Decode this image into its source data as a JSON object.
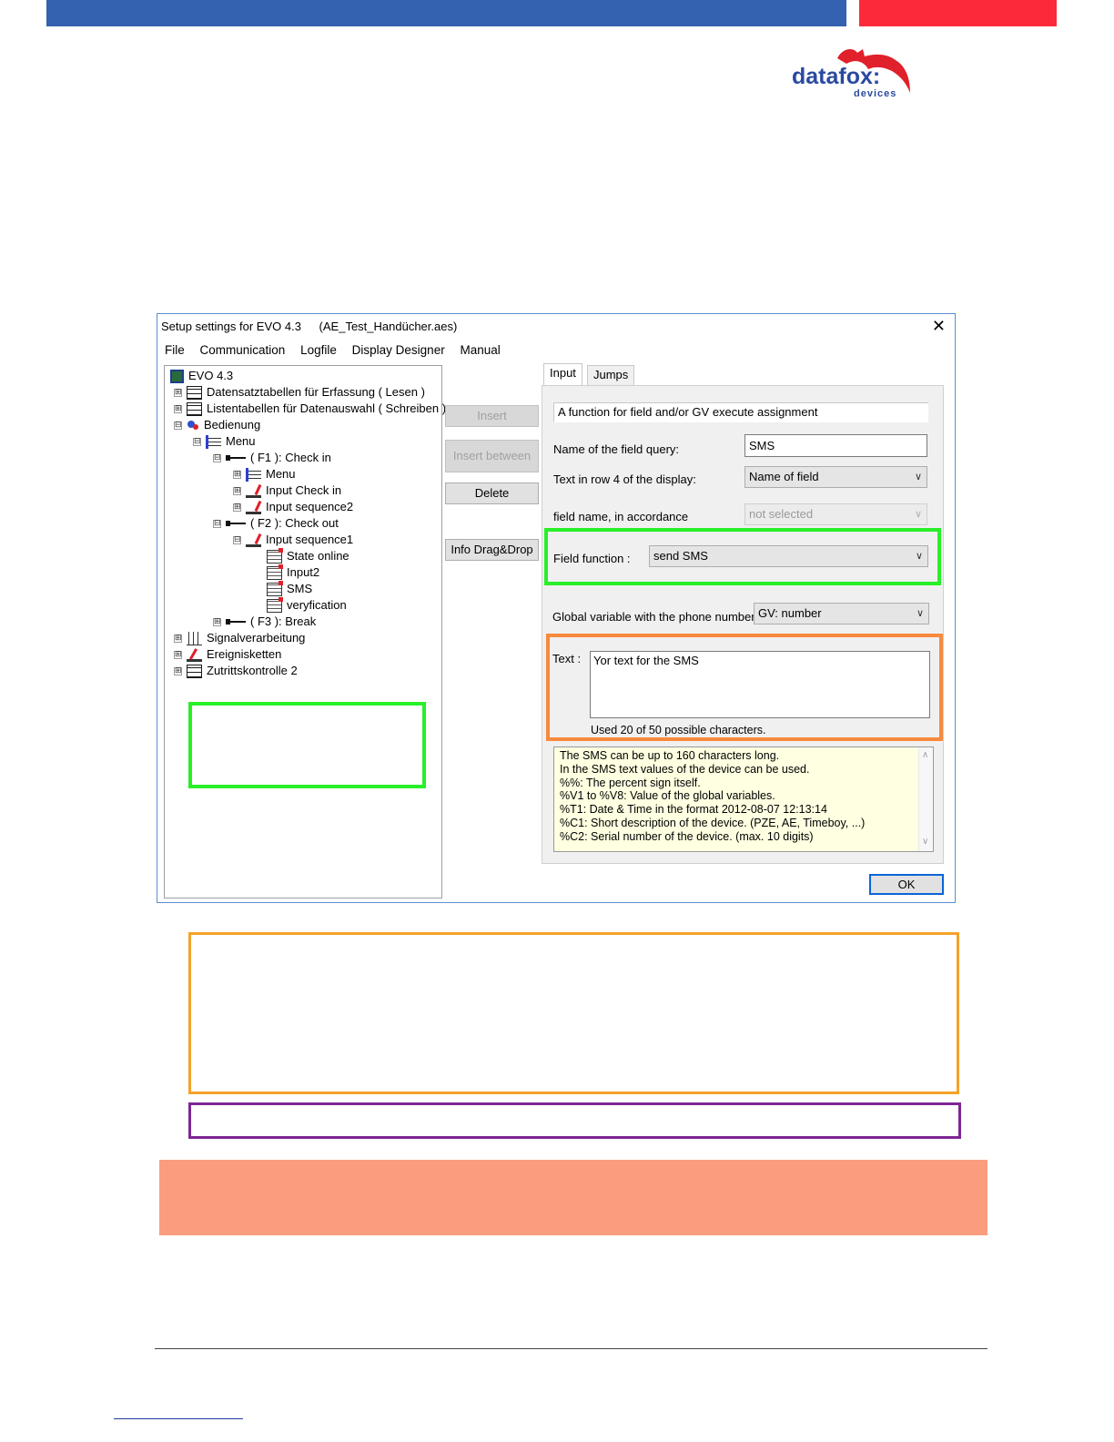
{
  "brand": {
    "logo_main": "datafox:",
    "logo_sub": "devices",
    "colors": {
      "blue_bar": "#3461b0",
      "red_bar": "#fb2a3a",
      "logo_blue": "#2a4aa0",
      "logo_red": "#e0202a"
    }
  },
  "window": {
    "title": "Setup settings for EVO 4.3",
    "file": "(AE_Test_Handücher.aes)",
    "close_icon": "close-icon"
  },
  "menu": [
    "File",
    "Communication",
    "Logfile",
    "Display Designer",
    "Manual"
  ],
  "tree": {
    "root": "EVO 4.3",
    "items": [
      "Datensatztabellen für Erfassung ( Lesen )",
      "Listentabellen für Datenauswahl ( Schreiben )",
      "Bedienung",
      "Menu",
      "( F1 ): Check in",
      "Menu",
      "Input Check in",
      "Input sequence2",
      "( F2 ): Check out",
      "Input sequence1",
      "State online",
      "Input2",
      "SMS",
      "veryfication",
      "( F3 ): Break",
      "Signalverarbeitung",
      "Ereignisketten",
      "Zutrittskontrolle 2"
    ],
    "expanders": {
      "collapsed": "⊞",
      "expanded": "⊟"
    }
  },
  "buttons": {
    "insert": "Insert",
    "insert_between": "Insert between",
    "delete": "Delete",
    "info_dragdrop": "Info Drag&Drop",
    "ok": "OK"
  },
  "tabs": [
    "Input",
    "Jumps"
  ],
  "form": {
    "description": "A function for field and/or GV execute assignment",
    "name_label": "Name of the field query:",
    "name_value": "SMS",
    "row4_label": "Text in row 4 of the display:",
    "row4_value": "Name of field",
    "fieldname_label": "field name, in accordance",
    "fieldname_value": "not selected",
    "function_label": "Field function :",
    "function_value": "send SMS",
    "gv_label": "Global variable with the phone number:",
    "gv_value": "GV: number",
    "text_label": "Text :",
    "text_value": "Yor text for the SMS",
    "used_text": "Used 20 of 50 possible characters.",
    "dropdown_icon": "chevron-down-icon"
  },
  "info_lines": [
    "The SMS can be up to 160 characters long.",
    "In the SMS text values of the device can be used.",
    "%%: The percent sign itself.",
    "%V1 to %V8: Value of the global variables.",
    "%T1: Date & Time in the format 2012-08-07 12:13:14",
    "%C1: Short description of the device. (PZE, AE, Timeboy, ...)",
    "%C2: Serial number of the device. (max. 10 digits)"
  ],
  "annotation_colors": {
    "green": "#29ef29",
    "orange": "#f78a3d",
    "amber": "#f5a229",
    "purple": "#7d2695",
    "salmon": "#f99d7e"
  }
}
